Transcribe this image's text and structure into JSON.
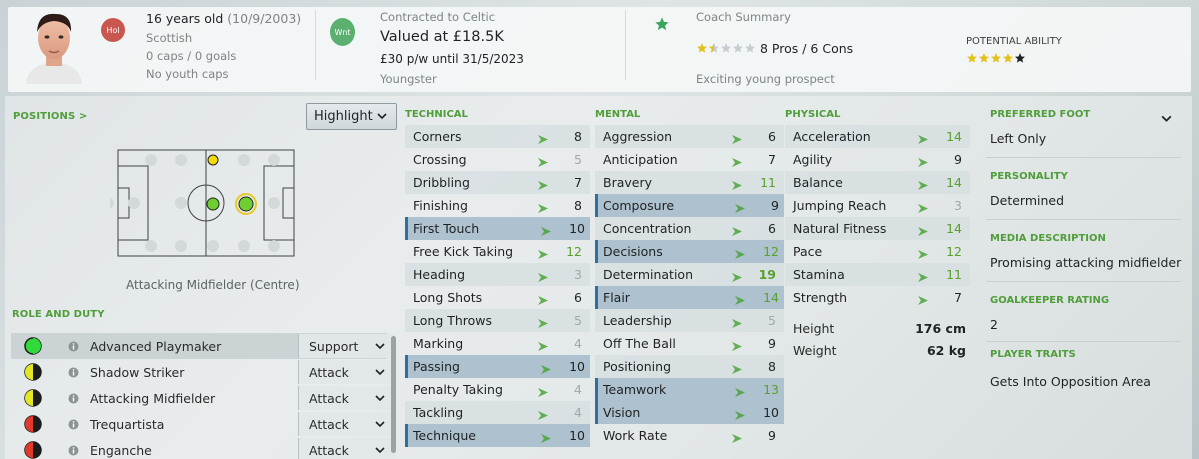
{
  "header": {
    "age_line": "16 years old",
    "dob": "(10/9/2003)",
    "nationality": "Scottish",
    "caps": "0 caps / 0 goals",
    "youth_caps": "No youth caps",
    "status_badge": "Hol",
    "wanted_badge": "Wnt",
    "contract": "Contracted to Celtic",
    "value": "Valued at £18.5K",
    "wage": "£30 p/w until 31/5/2023",
    "squad_status": "Youngster",
    "coach_summary_label": "Coach Summary",
    "pros_cons": "8 Pros / 6 Cons",
    "coach_stars": 1.5,
    "coach_comment": "Exciting young prospect",
    "potential_label": "POTENTIAL ABILITY",
    "potential_stars": 4
  },
  "positions": {
    "label": "POSITIONS >",
    "highlight": "Highlight",
    "position_name": "Attacking Midfielder (Centre)"
  },
  "roles": {
    "label": "ROLE AND DUTY",
    "items": [
      {
        "name": "Advanced Playmaker",
        "duty": "Support"
      },
      {
        "name": "Shadow Striker",
        "duty": "Attack"
      },
      {
        "name": "Attacking Midfielder",
        "duty": "Attack"
      },
      {
        "name": "Trequartista",
        "duty": "Attack"
      },
      {
        "name": "Enganche",
        "duty": "Attack"
      }
    ]
  },
  "technical": {
    "label": "TECHNICAL",
    "items": [
      {
        "name": "Corners",
        "value": "8"
      },
      {
        "name": "Crossing",
        "value": "5"
      },
      {
        "name": "Dribbling",
        "value": "7"
      },
      {
        "name": "Finishing",
        "value": "8"
      },
      {
        "name": "First Touch",
        "value": "10"
      },
      {
        "name": "Free Kick Taking",
        "value": "12"
      },
      {
        "name": "Heading",
        "value": "3"
      },
      {
        "name": "Long Shots",
        "value": "6"
      },
      {
        "name": "Long Throws",
        "value": "5"
      },
      {
        "name": "Marking",
        "value": "4"
      },
      {
        "name": "Passing",
        "value": "10"
      },
      {
        "name": "Penalty Taking",
        "value": "4"
      },
      {
        "name": "Tackling",
        "value": "4"
      },
      {
        "name": "Technique",
        "value": "10"
      }
    ]
  },
  "mental": {
    "label": "MENTAL",
    "items": [
      {
        "name": "Aggression",
        "value": "6"
      },
      {
        "name": "Anticipation",
        "value": "7"
      },
      {
        "name": "Bravery",
        "value": "11"
      },
      {
        "name": "Composure",
        "value": "9"
      },
      {
        "name": "Concentration",
        "value": "6"
      },
      {
        "name": "Decisions",
        "value": "12"
      },
      {
        "name": "Determination",
        "value": "19"
      },
      {
        "name": "Flair",
        "value": "14"
      },
      {
        "name": "Leadership",
        "value": "5"
      },
      {
        "name": "Off The Ball",
        "value": "9"
      },
      {
        "name": "Positioning",
        "value": "8"
      },
      {
        "name": "Teamwork",
        "value": "13"
      },
      {
        "name": "Vision",
        "value": "10"
      },
      {
        "name": "Work Rate",
        "value": "9"
      }
    ]
  },
  "physical": {
    "label": "PHYSICAL",
    "items": [
      {
        "name": "Acceleration",
        "value": "14"
      },
      {
        "name": "Agility",
        "value": "9"
      },
      {
        "name": "Balance",
        "value": "14"
      },
      {
        "name": "Jumping Reach",
        "value": "3"
      },
      {
        "name": "Natural Fitness",
        "value": "14"
      },
      {
        "name": "Pace",
        "value": "12"
      },
      {
        "name": "Stamina",
        "value": "11"
      },
      {
        "name": "Strength",
        "value": "7"
      }
    ],
    "height_label": "Height",
    "height": "176 cm",
    "weight_label": "Weight",
    "weight": "62 kg"
  },
  "info": {
    "preferred_foot_label": "PREFERRED FOOT",
    "preferred_foot": "Left Only",
    "personality_label": "PERSONALITY",
    "personality": "Determined",
    "media_label": "MEDIA DESCRIPTION",
    "media": "Promising attacking midfielder",
    "gk_label": "GOALKEEPER RATING",
    "gk_rating": "2",
    "traits_label": "PLAYER TRAITS",
    "traits": "Gets Into Opposition Area"
  },
  "colors": {
    "accent_green": "#4f9e3a",
    "highlight_blue": "#2f6fa0",
    "star_gold": "#e2c21a"
  }
}
